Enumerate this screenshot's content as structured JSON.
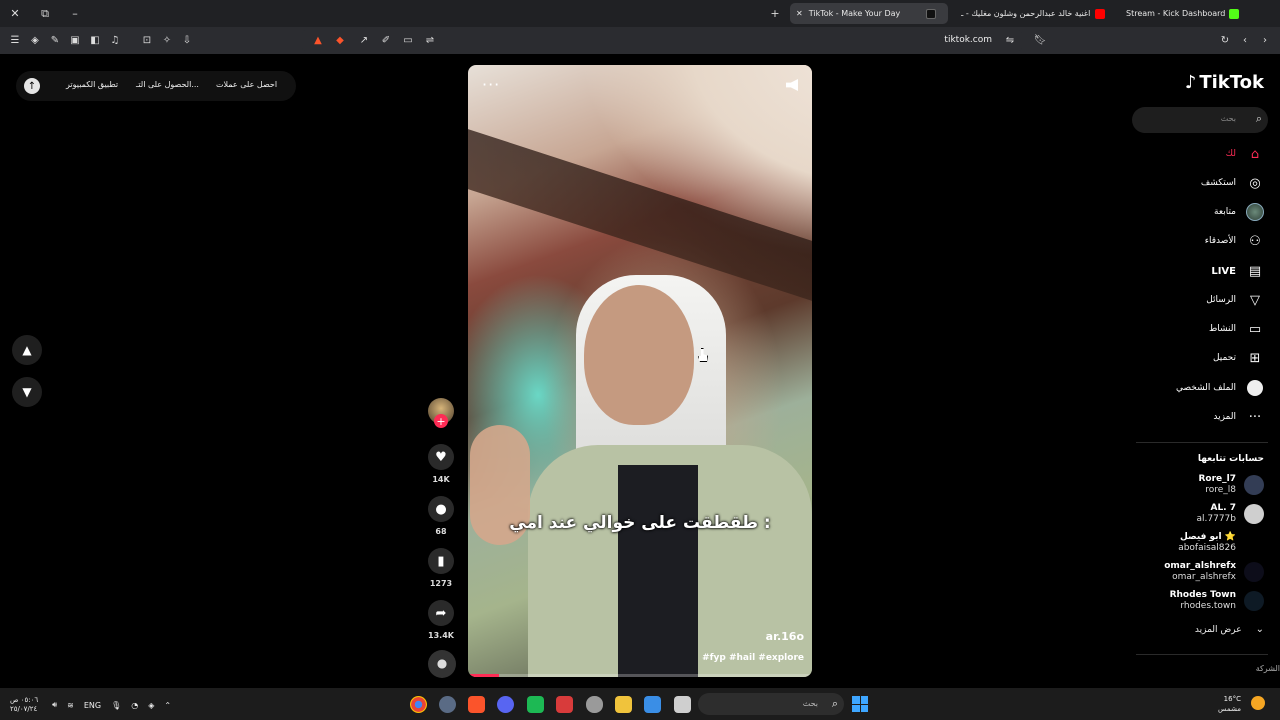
{
  "browser": {
    "tabs": [
      {
        "label": "Stream - Kick Dashboard",
        "active": false
      },
      {
        "label": "اغنية خالد عبدالرحمن وشلون مغليك - ـ",
        "active": false
      },
      {
        "label": "TikTok - Make Your Day",
        "active": true
      }
    ],
    "url": "tiktok.com"
  },
  "promo": {
    "items": [
      "احصل على عملات",
      "الحصول على التـ...",
      "تطبيق الكمبيوتر"
    ]
  },
  "video": {
    "caption": "طقطقت على خوالي عند امي :",
    "author": "ar.16o",
    "hashtags": "#fyp #hail #explore",
    "progress": 0.09
  },
  "actions": {
    "likes": "14K",
    "comments": "68",
    "bookmarks": "1273",
    "shares": "13.4K"
  },
  "sidebar": {
    "logo": "TikTok",
    "search_placeholder": "بحث",
    "nav": [
      {
        "label": "لك",
        "icon": "home-icon",
        "active": true
      },
      {
        "label": "استكشف",
        "icon": "compass-icon",
        "active": false
      },
      {
        "label": "متابعة",
        "icon": "following-avatar-icon",
        "active": false
      },
      {
        "label": "الأصدقاء",
        "icon": "friends-icon",
        "active": false
      },
      {
        "label": "LIVE",
        "icon": "live-icon",
        "active": false
      },
      {
        "label": "الرسائل",
        "icon": "messages-icon",
        "active": false
      },
      {
        "label": "النشاط",
        "icon": "activity-icon",
        "active": false
      },
      {
        "label": "تحميل",
        "icon": "upload-icon",
        "active": false
      },
      {
        "label": "الملف الشخصي",
        "icon": "profile-icon",
        "active": false
      },
      {
        "label": "المزيد",
        "icon": "more-icon",
        "active": false
      }
    ],
    "following_title": "حسابات تتابعها",
    "following": [
      {
        "name": "Rore_l7",
        "handle": "rore_l8"
      },
      {
        "name": "AL. 7",
        "handle": "al.7777b"
      },
      {
        "name": "ابو فيصل ⭐",
        "handle": "abofaisal826"
      },
      {
        "name": "omar_alshrefx",
        "handle": "omar_alshrefx"
      },
      {
        "name": "Rhodes Town",
        "handle": "rhodes.town"
      }
    ],
    "see_more": "عرض المزيد",
    "company": "الشركة"
  },
  "taskbar": {
    "search_placeholder": "بحث",
    "lang": "ENG",
    "time": "٠٥:٠٦ ص",
    "date": "٢٥/٠٧/٢٤",
    "weather_temp": "16°C",
    "weather_desc": "مشمس"
  },
  "colors": {
    "accent": "#fe2c55",
    "background": "#000000"
  }
}
